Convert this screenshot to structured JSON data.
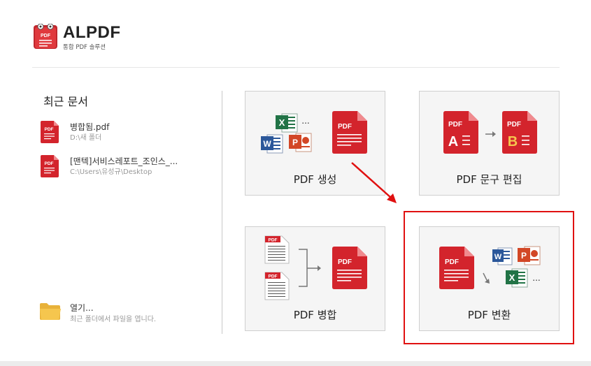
{
  "app": {
    "name": "ALPDF",
    "subtitle": "통합 PDF 솔루션",
    "logo_text": "PDF"
  },
  "recent": {
    "title": "최근 문서",
    "items": [
      {
        "name": "병합됨.pdf",
        "path": "D:\\새 폴더"
      },
      {
        "name": "[맨텍]서비스레포트_조인스_...",
        "path": "C:\\Users\\유성규\\Desktop"
      }
    ]
  },
  "open": {
    "label": "열기...",
    "description": "최근 폴더에서 파일을 엽니다."
  },
  "tiles": {
    "create": {
      "label": "PDF 생성"
    },
    "edit": {
      "label": "PDF 문구 편집",
      "from": "A",
      "to": "B"
    },
    "merge": {
      "label": "PDF 병합"
    },
    "convert": {
      "label": "PDF 변환"
    }
  },
  "icon_text": {
    "pdf": "PDF",
    "word": "W",
    "excel": "X",
    "ppt": "P",
    "more": "..."
  },
  "colors": {
    "pdf_red": "#d3242c",
    "word_blue": "#2b579a",
    "excel_green": "#217346",
    "ppt_orange": "#d24726",
    "annotation_red": "#e01010",
    "folder_yellow": "#f5c64e"
  }
}
